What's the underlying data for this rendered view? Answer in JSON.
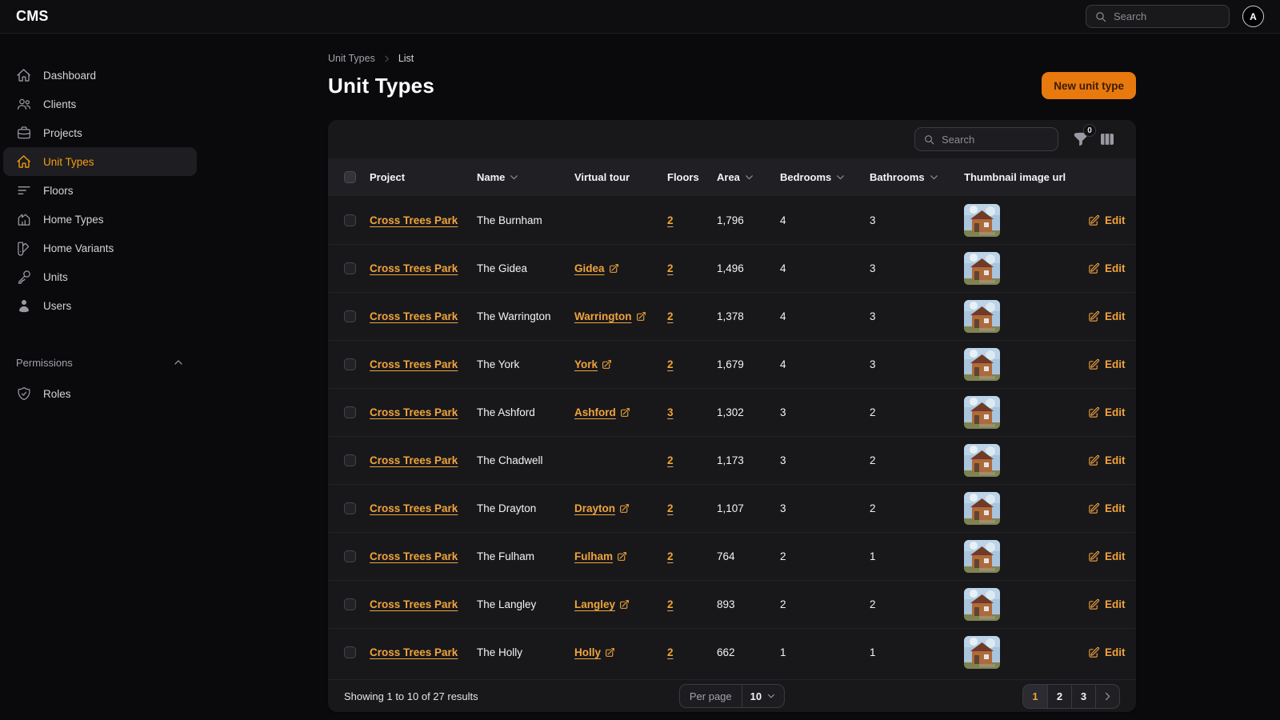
{
  "topbar": {
    "brand": "CMS",
    "search_placeholder": "Search",
    "avatar_initial": "A"
  },
  "sidebar": {
    "items": [
      {
        "label": "Dashboard",
        "icon": "home-icon"
      },
      {
        "label": "Clients",
        "icon": "clients-icon"
      },
      {
        "label": "Projects",
        "icon": "briefcase-icon"
      },
      {
        "label": "Unit Types",
        "icon": "home-icon",
        "active": true
      },
      {
        "label": "Floors",
        "icon": "bars-icon"
      },
      {
        "label": "Home Types",
        "icon": "home-chart-icon"
      },
      {
        "label": "Home Variants",
        "icon": "swatch-icon"
      },
      {
        "label": "Units",
        "icon": "key-icon"
      },
      {
        "label": "Users",
        "icon": "user-icon"
      }
    ],
    "section_label": "Permissions",
    "section_items": [
      {
        "label": "Roles",
        "icon": "shield-check-icon"
      }
    ]
  },
  "page": {
    "breadcrumb": {
      "parent": "Unit Types",
      "current": "List"
    },
    "title": "Unit Types",
    "new_button_label": "New unit type"
  },
  "table": {
    "search_placeholder": "Search",
    "filter_badge": "0",
    "columns": {
      "project": "Project",
      "name": "Name",
      "virtual_tour": "Virtual tour",
      "floors": "Floors",
      "area": "Area",
      "bedrooms": "Bedrooms",
      "bathrooms": "Bathrooms",
      "thumbnail": "Thumbnail image url"
    },
    "edit_label": "Edit",
    "rows": [
      {
        "project": "Cross Trees Park",
        "name": "The Burnham",
        "virtual_tour": "",
        "floors": "2",
        "area": "1,796",
        "bedrooms": "4",
        "bathrooms": "3"
      },
      {
        "project": "Cross Trees Park",
        "name": "The Gidea",
        "virtual_tour": "Gidea",
        "floors": "2",
        "area": "1,496",
        "bedrooms": "4",
        "bathrooms": "3"
      },
      {
        "project": "Cross Trees Park",
        "name": "The Warrington",
        "virtual_tour": "Warrington",
        "floors": "2",
        "area": "1,378",
        "bedrooms": "4",
        "bathrooms": "3"
      },
      {
        "project": "Cross Trees Park",
        "name": "The York",
        "virtual_tour": "York",
        "floors": "2",
        "area": "1,679",
        "bedrooms": "4",
        "bathrooms": "3"
      },
      {
        "project": "Cross Trees Park",
        "name": "The Ashford",
        "virtual_tour": "Ashford",
        "floors": "3",
        "area": "1,302",
        "bedrooms": "3",
        "bathrooms": "2"
      },
      {
        "project": "Cross Trees Park",
        "name": "The Chadwell",
        "virtual_tour": "",
        "floors": "2",
        "area": "1,173",
        "bedrooms": "3",
        "bathrooms": "2"
      },
      {
        "project": "Cross Trees Park",
        "name": "The Drayton",
        "virtual_tour": "Drayton",
        "floors": "2",
        "area": "1,107",
        "bedrooms": "3",
        "bathrooms": "2"
      },
      {
        "project": "Cross Trees Park",
        "name": "The Fulham",
        "virtual_tour": "Fulham",
        "floors": "2",
        "area": "764",
        "bedrooms": "2",
        "bathrooms": "1"
      },
      {
        "project": "Cross Trees Park",
        "name": "The Langley",
        "virtual_tour": "Langley",
        "floors": "2",
        "area": "893",
        "bedrooms": "2",
        "bathrooms": "2"
      },
      {
        "project": "Cross Trees Park",
        "name": "The Holly",
        "virtual_tour": "Holly",
        "floors": "2",
        "area": "662",
        "bedrooms": "1",
        "bathrooms": "1"
      }
    ],
    "footer": {
      "summary": "Showing 1 to 10 of 27 results",
      "per_page_label": "Per page",
      "per_page_value": "10",
      "pages": [
        "1",
        "2",
        "3"
      ],
      "active_page": "1"
    }
  },
  "colors": {
    "accent_link": "#f0a43c",
    "primary_button": "#e8790e",
    "card_bg": "#18181b",
    "page_bg": "#0a0a0c"
  }
}
